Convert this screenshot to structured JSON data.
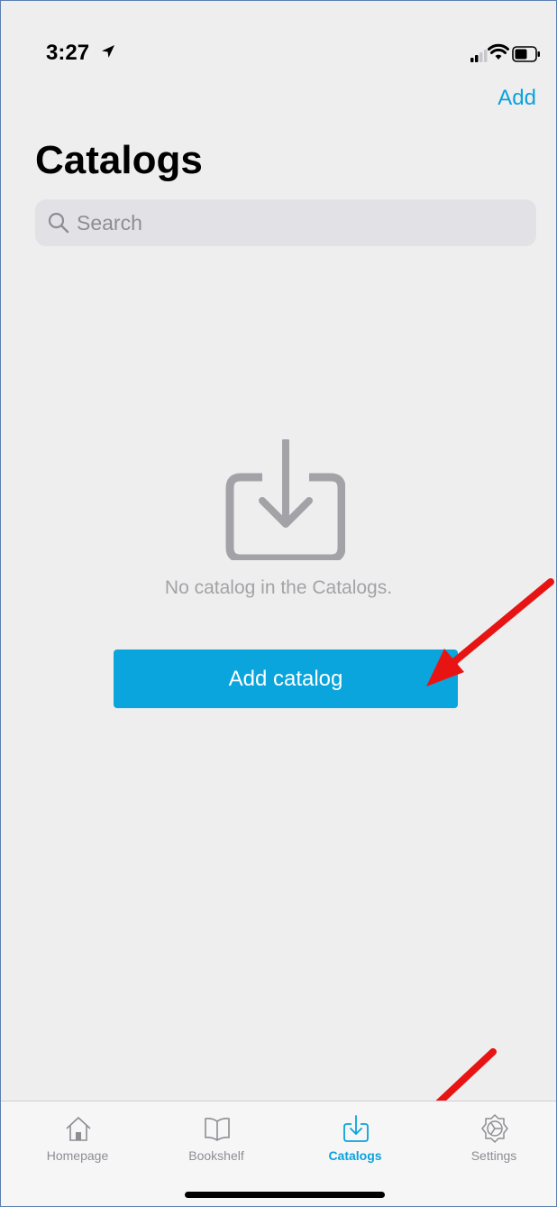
{
  "status_bar": {
    "time": "3:27"
  },
  "nav": {
    "add_label": "Add"
  },
  "page": {
    "title": "Catalogs"
  },
  "search": {
    "placeholder": "Search",
    "value": ""
  },
  "empty_state": {
    "icon": "download-tray-icon",
    "message": "No catalog in the Catalogs.",
    "button_label": "Add catalog"
  },
  "tab_bar": {
    "tabs": [
      {
        "label": "Homepage",
        "icon": "house-icon",
        "active": false
      },
      {
        "label": "Bookshelf",
        "icon": "open-book-icon",
        "active": false
      },
      {
        "label": "Catalogs",
        "icon": "download-tray-icon",
        "active": true
      },
      {
        "label": "Settings",
        "icon": "gear-icon",
        "active": false
      }
    ]
  },
  "colors": {
    "accent": "#0aa2dc",
    "button": "#0aa5dc",
    "background": "#efeeef",
    "annotation": "#e81414"
  }
}
